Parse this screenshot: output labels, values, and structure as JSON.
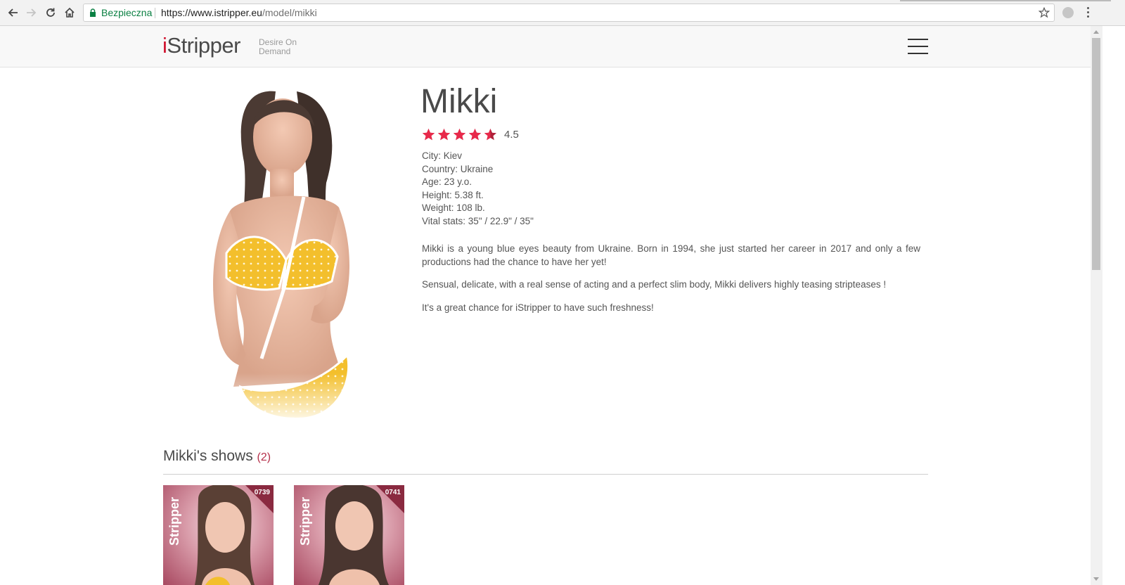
{
  "browser": {
    "secure_label": "Bezpieczna",
    "url_host": "https://www.istripper.eu",
    "url_path": "/model/mikki"
  },
  "header": {
    "logo_i": "i",
    "logo_rest": "Stripper",
    "tagline": "Desire On Demand"
  },
  "model": {
    "name": "Mikki",
    "rating": 4.5,
    "rating_text": "4.5",
    "stats": [
      "City: Kiev",
      "Country: Ukraine",
      "Age: 23 y.o.",
      "Height: 5.38 ft.",
      "Weight: 108 lb.",
      "Vital stats: 35\" / 22.9\" / 35\""
    ],
    "bio": [
      "Mikki is a young blue eyes beauty from Ukraine. Born in 1994, she just started her career in 2017 and only a few productions had the chance to have her yet!",
      "Sensual, delicate, with a real sense of acting and a perfect slim body, Mikki delivers highly teasing stripteases !",
      "It's a great chance for iStripper to have such freshness!"
    ]
  },
  "shows": {
    "title": "Mikki's shows",
    "count": "(2)",
    "cards": [
      {
        "brand": "Stripper",
        "code": "0739"
      },
      {
        "brand": "Stripper",
        "code": "0741"
      }
    ]
  },
  "colors": {
    "accent": "#d0122f",
    "star": "#e8294a",
    "text": "#555555"
  }
}
